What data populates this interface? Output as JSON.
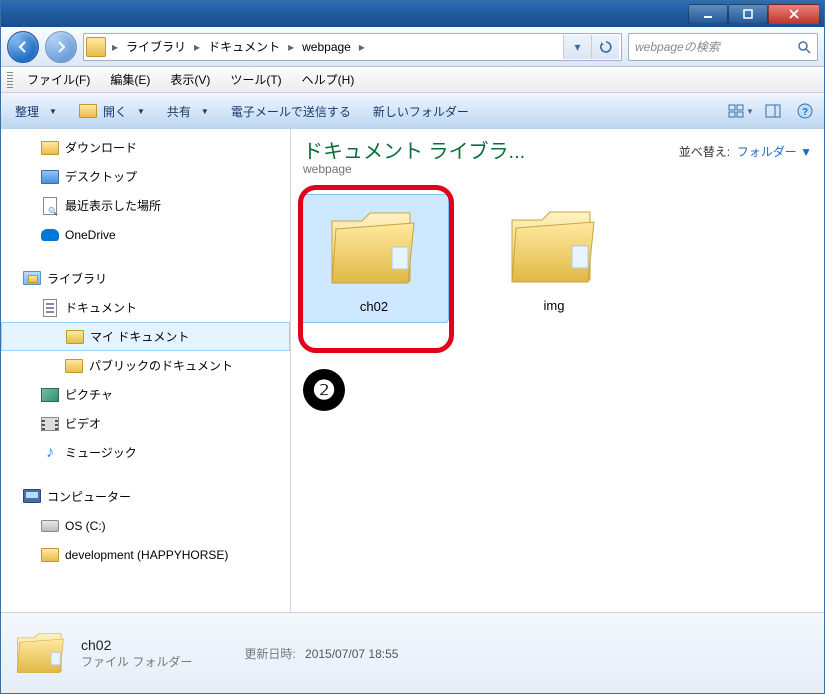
{
  "titlebar": {},
  "breadcrumb": {
    "items": [
      "ライブラリ",
      "ドキュメント",
      "webpage"
    ]
  },
  "search": {
    "placeholder": "webpageの検索"
  },
  "menubar": {
    "items": [
      "ファイル(F)",
      "編集(E)",
      "表示(V)",
      "ツール(T)",
      "ヘルプ(H)"
    ]
  },
  "toolbar": {
    "organize": "整理",
    "open": "開く",
    "share": "共有",
    "send_email": "電子メールで送信する",
    "new_folder": "新しいフォルダー"
  },
  "sidebar": {
    "items": [
      {
        "icon": "folder",
        "label": "ダウンロード",
        "indent": 0
      },
      {
        "icon": "desktop",
        "label": "デスクトップ",
        "indent": 0
      },
      {
        "icon": "recent",
        "label": "最近表示した場所",
        "indent": 0
      },
      {
        "icon": "onedrive",
        "label": "OneDrive",
        "indent": 0
      }
    ],
    "library_group": "ライブラリ",
    "library_items": [
      {
        "icon": "doc",
        "label": "ドキュメント"
      },
      {
        "icon": "folder",
        "label": "マイ ドキュメント",
        "selected": true,
        "indent": 1
      },
      {
        "icon": "folder",
        "label": "パブリックのドキュメント",
        "indent": 1
      },
      {
        "icon": "pic",
        "label": "ピクチャ"
      },
      {
        "icon": "vid",
        "label": "ビデオ"
      },
      {
        "icon": "music",
        "label": "ミュージック"
      }
    ],
    "computer_group": "コンピューター",
    "computer_items": [
      {
        "icon": "drive",
        "label": "OS (C:)"
      },
      {
        "icon": "folder",
        "label": "development (HAPPYHORSE)",
        "indent": 1
      }
    ]
  },
  "main": {
    "library_title": "ドキュメント ライブラ...",
    "library_subtitle": "webpage",
    "sort_label": "並べ替え:",
    "sort_value": "フォルダー",
    "folders": [
      {
        "name": "ch02",
        "selected": true
      },
      {
        "name": "img",
        "selected": false
      }
    ],
    "callout": "❷"
  },
  "details": {
    "name": "ch02",
    "type": "ファイル フォルダー",
    "modified_label": "更新日時:",
    "modified_value": "2015/07/07 18:55"
  }
}
